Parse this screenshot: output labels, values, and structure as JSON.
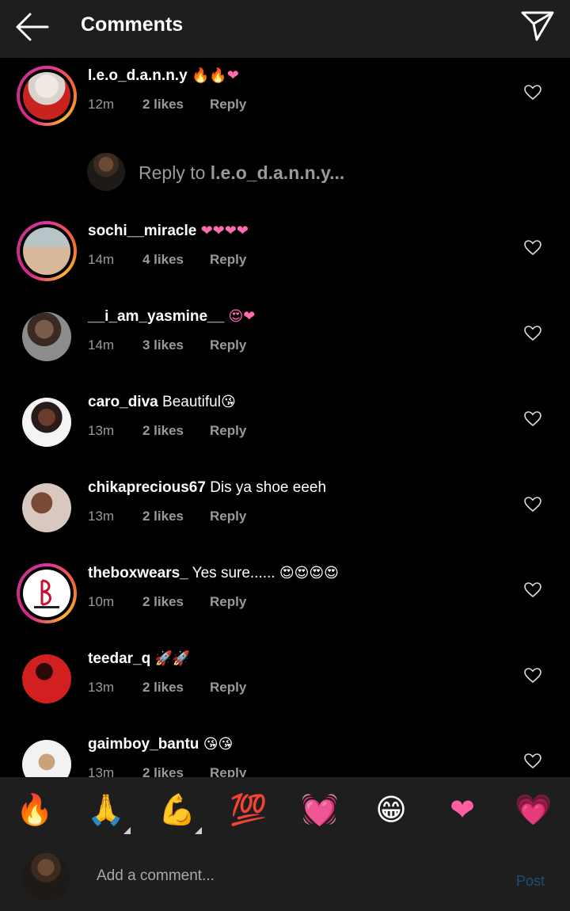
{
  "header": {
    "title": "Comments"
  },
  "main_comment": {
    "username": "l.e.o_d.a.n.n.y",
    "emojis": "🔥🔥❤",
    "time": "12m",
    "likes": "2 likes",
    "reply": "Reply"
  },
  "reply_prompt": {
    "prefix": "Reply to ",
    "target": "l.e.o_d.a.n.n.y..."
  },
  "comments": [
    {
      "username": "sochi__miracle",
      "text": "",
      "emojis": "❤❤❤❤",
      "time": "14m",
      "likes": "4 likes",
      "reply": "Reply"
    },
    {
      "username": "__i_am_yasmine__",
      "text": "",
      "emojis": "😍❤",
      "time": "14m",
      "likes": "3 likes",
      "reply": "Reply"
    },
    {
      "username": "caro_diva",
      "text": "Beautiful",
      "emojis": "😘",
      "time": "13m",
      "likes": "2 likes",
      "reply": "Reply"
    },
    {
      "username": "chikaprecious67",
      "text": "Dis ya shoe eeeh",
      "emojis": "",
      "time": "13m",
      "likes": "2 likes",
      "reply": "Reply"
    },
    {
      "username": "theboxwears_",
      "text": "Yes sure......",
      "emojis": "😍😍😍😍",
      "time": "10m",
      "likes": "2 likes",
      "reply": "Reply"
    },
    {
      "username": "teedar_q",
      "text": "",
      "emojis": "🚀🚀",
      "time": "13m",
      "likes": "2 likes",
      "reply": "Reply"
    },
    {
      "username": "gaimboy_bantu",
      "text": "",
      "emojis": "😘😘",
      "time": "13m",
      "likes": "2 likes",
      "reply": "Reply"
    }
  ],
  "emoji_bar": [
    "🔥",
    "🙏",
    "💪",
    "💯",
    "💓",
    "😁",
    "❤",
    "💗"
  ],
  "compose": {
    "placeholder": "Add a comment...",
    "post_label": "Post"
  },
  "colors": {
    "background": "#000000",
    "bar": "#1e1e1e",
    "muted_text": "#9a9a9a",
    "post_disabled": "#1d4f7a",
    "story_ring": "#d9248a"
  }
}
